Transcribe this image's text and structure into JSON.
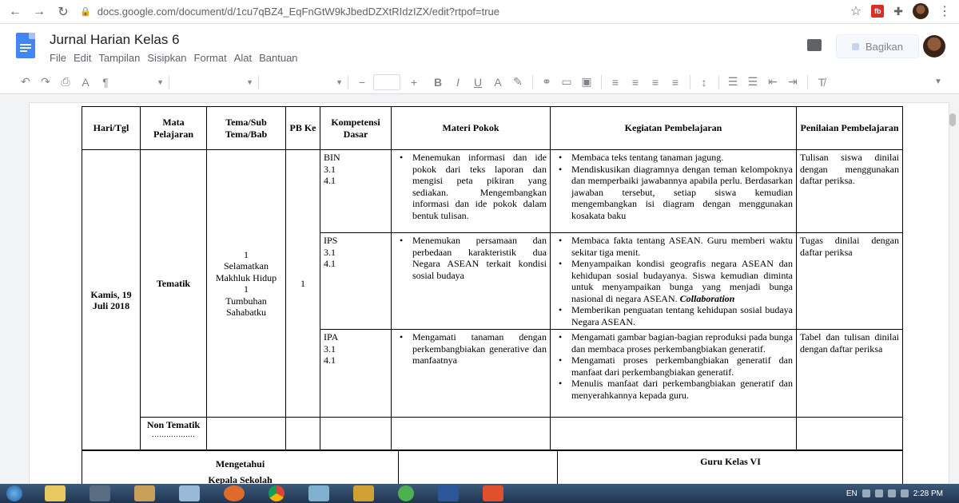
{
  "browser": {
    "url": "docs.google.com/document/d/1cu7qBZ4_EqFnGtW9kJbedDZXtRIdzIZX/edit?rtpof=true",
    "icons": [
      "back-icon",
      "forward-icon",
      "reload-icon",
      "lock-icon",
      "star-icon",
      "extension-icon",
      "puzzle-icon",
      "profile-avatar",
      "menu-icon"
    ]
  },
  "doc": {
    "title": "Jurnal Harian Kelas 6",
    "menu": [
      "File",
      "Edit",
      "Tampilan",
      "Sisipkan",
      "Format",
      "Alat",
      "Bantuan"
    ],
    "share_label": "Bagikan"
  },
  "table": {
    "headers": {
      "hari": "Hari/Tgl",
      "mapel": "Mata Pelajaran",
      "tema": "Tema/Sub Tema/Bab",
      "pb": "PB Ke",
      "kd": "Kompetensi Dasar",
      "materi": "Materi Pokok",
      "kegiatan": "Kegiatan Pembelajaran",
      "penilaian": "Penilaian Pembelajaran"
    },
    "hari": "Kamis, 19 Juli 2018",
    "mapel_tematik": "Tematik",
    "mapel_nontematik": "Non Tematik",
    "mapel_nontematik_dots": "………………",
    "tema": [
      "1",
      "Selamatkan",
      "Makhluk Hidup",
      "1",
      "Tumbuhan",
      "Sahabatku"
    ],
    "pb": "1",
    "rows": [
      {
        "kd": [
          "BIN",
          "3.1",
          "4.1"
        ],
        "materi": "Menemukan informasi dan ide pokok dari teks laporan dan mengisi peta pikiran yang sediakan. Mengembangkan informasi dan ide pokok dalam bentuk tulisan.",
        "kegiatan": [
          "Membaca teks tentang tanaman jagung.",
          "Mendiskusikan diagramnya dengan teman kelompoknya dan memperbaiki jawabannya apabila perlu. Berdasarkan jawaban tersebut, setiap siswa kemudian mengembangkan isi diagram dengan menggunakan kosakata baku"
        ],
        "penilaian": "Tulisan siswa dinilai dengan menggunakan daftar periksa."
      },
      {
        "kd": [
          "IPS",
          "3.1",
          "4.1"
        ],
        "materi": "Menemukan persamaan dan perbedaan karakteristik dua Negara ASEAN terkait kondisi sosial budaya",
        "kegiatan": [
          "Membaca fakta tentang ASEAN. Guru memberi waktu sekitar tiga menit.",
          "Menyampaikan kondisi geografis negara ASEAN dan kehidupan sosial budayanya. Siswa kemudian diminta untuk menyampaikan bunga yang menjadi bunga nasional di negara ASEAN.",
          "Memberikan penguatan tentang kehidupan sosial budaya Negara ASEAN."
        ],
        "kegiatan_emph": "Collaboration",
        "penilaian": "Tugas dinilai dengan daftar periksa"
      },
      {
        "kd": [
          "IPA",
          "3.1",
          "4.1"
        ],
        "materi": "Mengamati tanaman dengan perkembangbiakan generative dan manfaatnya",
        "kegiatan": [
          "Mengamati gambar bagian-bagian reproduksi pada bunga dan membaca proses perkembangbiakan generatif.",
          "Mengamati proses perkembangbiakan generatif dan manfaat dari perkembangbiakan generatif.",
          "Menulis manfaat dari perkembangbiakan generatif dan menyerahkannya kepada guru."
        ],
        "penilaian": "Tabel dan tulisan dinilai dengan daftar periksa"
      }
    ]
  },
  "signature": {
    "left_line1": "Mengetahui",
    "left_line2": "Kepala Sekolah",
    "right": "Guru Kelas VI"
  },
  "taskbar": {
    "lang": "EN",
    "time": "2:28 PM"
  }
}
